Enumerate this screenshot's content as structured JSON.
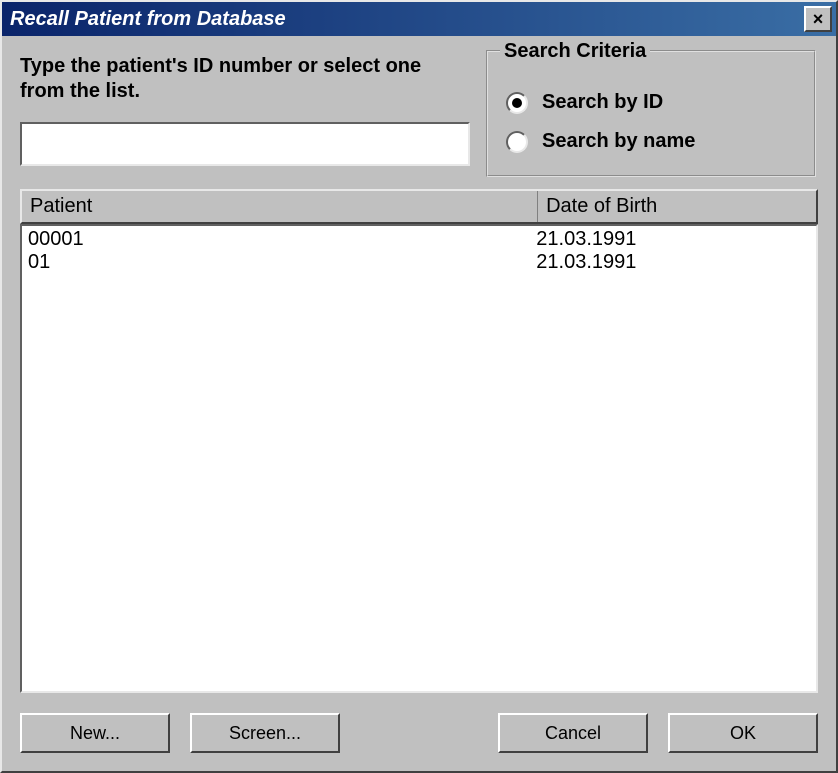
{
  "window": {
    "title": "Recall Patient from Database"
  },
  "instruction": "Type the patient's ID number or select one from the list.",
  "search_input": {
    "value": "",
    "placeholder": ""
  },
  "search_criteria": {
    "group_label": "Search Criteria",
    "options": [
      {
        "label": "Search by ID",
        "selected": true
      },
      {
        "label": "Search by name",
        "selected": false
      }
    ]
  },
  "table": {
    "columns": {
      "patient": "Patient",
      "dob": "Date of Birth"
    },
    "rows": [
      {
        "patient": "00001",
        "dob": "21.03.1991"
      },
      {
        "patient": "01",
        "dob": "21.03.1991"
      }
    ]
  },
  "buttons": {
    "new": "New...",
    "screen": "Screen...",
    "cancel": "Cancel",
    "ok": "OK"
  }
}
